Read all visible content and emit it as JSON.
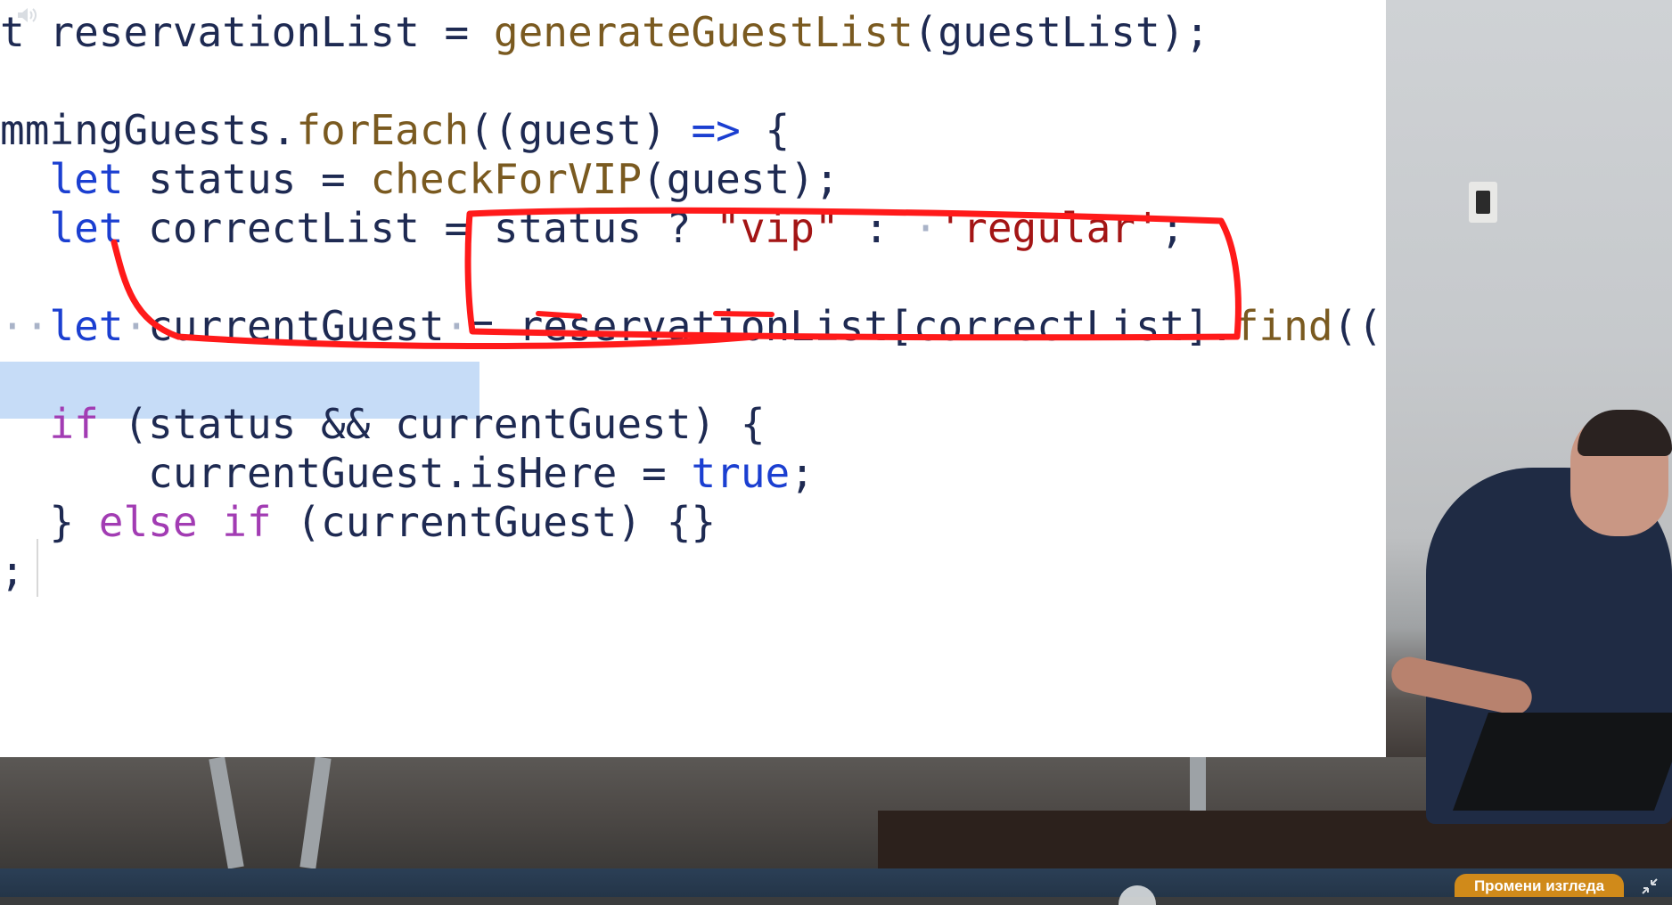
{
  "code_lines": [
    [
      [
        "tok-var",
        "t "
      ],
      [
        "tok-var",
        "reservationList"
      ],
      [
        "tok-op",
        " = "
      ],
      [
        "tok-fn",
        "generateGuestList"
      ],
      [
        "tok-var",
        "(guestList);"
      ]
    ],
    [],
    [
      [
        "tok-var",
        "mmingGuests."
      ],
      [
        "tok-fn",
        "forEach"
      ],
      [
        "tok-var",
        "((guest) "
      ],
      [
        "tok-arr",
        "=>"
      ],
      [
        "tok-var",
        " {"
      ]
    ],
    [
      [
        "tok-var",
        "  "
      ],
      [
        "tok-kw",
        "let"
      ],
      [
        "tok-var",
        " status = "
      ],
      [
        "tok-fn",
        "checkForVIP"
      ],
      [
        "tok-var",
        "(guest);"
      ]
    ],
    [
      [
        "tok-var",
        "  "
      ],
      [
        "tok-kw",
        "let"
      ],
      [
        "tok-var",
        " correctList = status ? "
      ],
      [
        "tok-str",
        "\"vip\""
      ],
      [
        "tok-var",
        " : "
      ],
      [
        "tok-ws",
        "·"
      ],
      [
        "tok-str",
        "'regular'"
      ],
      [
        "tok-var",
        ";"
      ]
    ],
    [],
    [
      [
        "tok-ws",
        "··"
      ],
      [
        "tok-kw",
        "let"
      ],
      [
        "tok-ws",
        "·"
      ],
      [
        "tok-var",
        "currentGuest"
      ],
      [
        "tok-ws",
        "·"
      ],
      [
        "tok-var",
        "= reservationList[correctList]."
      ],
      [
        "tok-fn",
        "find"
      ],
      [
        "tok-var",
        "((c"
      ]
    ],
    [],
    [
      [
        "tok-var",
        "  "
      ],
      [
        "tok-ctl",
        "if"
      ],
      [
        "tok-var",
        " (status && currentGuest) {"
      ]
    ],
    [
      [
        "tok-var",
        "      currentGuest.isHere = "
      ],
      [
        "tok-kw",
        "true"
      ],
      [
        "tok-var",
        ";"
      ]
    ],
    [
      [
        "tok-var",
        "  } "
      ],
      [
        "tok-ctl",
        "else if"
      ],
      [
        "tok-var",
        " (currentGuest) {}"
      ]
    ],
    [
      [
        "tok-var",
        ";"
      ]
    ]
  ],
  "player": {
    "change_view_label": "Промени изгледа"
  },
  "colors": {
    "annotation": "#ff1a1a",
    "selection": "#c6dcf7",
    "keyword": "#1b3fd1",
    "function": "#7a5a20",
    "string": "#a31515",
    "control": "#a23cb3",
    "button": "#d08a1a"
  }
}
